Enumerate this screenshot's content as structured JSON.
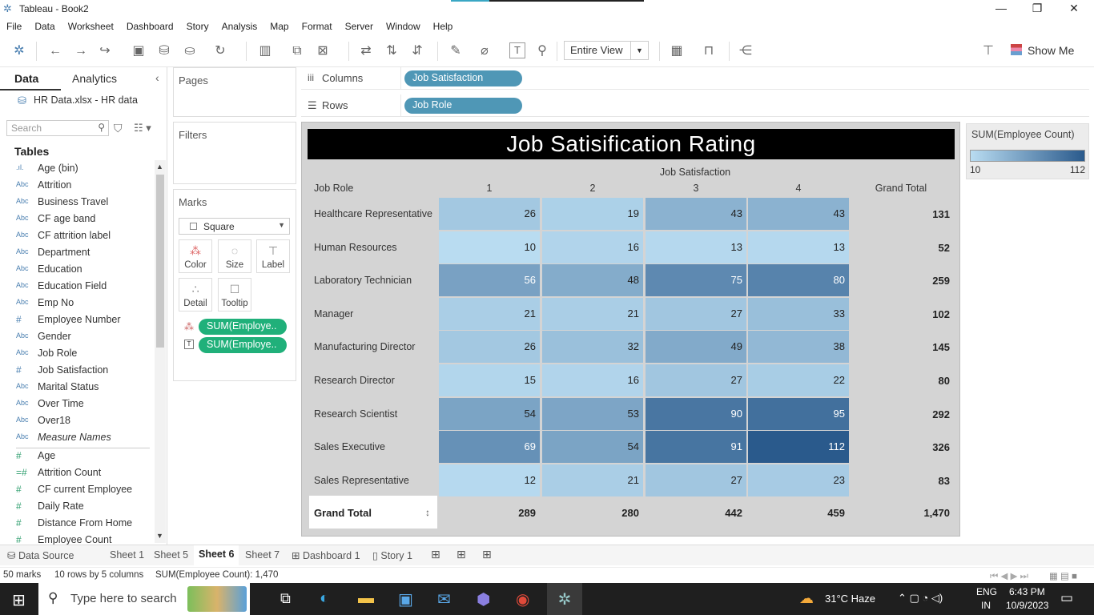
{
  "window": {
    "title": "Tableau - Book2"
  },
  "menu": [
    "File",
    "Data",
    "Worksheet",
    "Dashboard",
    "Story",
    "Analysis",
    "Map",
    "Format",
    "Server",
    "Window",
    "Help"
  ],
  "toolbar": {
    "fit": "Entire View",
    "show_me": "Show Me"
  },
  "data_pane": {
    "tab_data": "Data",
    "tab_analytics": "Analytics",
    "source": "HR Data.xlsx - HR data",
    "search_placeholder": "Search",
    "tables_label": "Tables",
    "dimensions": [
      {
        "type": "bin",
        "name": "Age (bin)"
      },
      {
        "type": "Abc",
        "name": "Attrition"
      },
      {
        "type": "Abc",
        "name": "Business Travel"
      },
      {
        "type": "Abc",
        "name": "CF age band"
      },
      {
        "type": "Abc",
        "name": "CF attrition label"
      },
      {
        "type": "Abc",
        "name": "Department"
      },
      {
        "type": "Abc",
        "name": "Education"
      },
      {
        "type": "Abc",
        "name": "Education Field"
      },
      {
        "type": "Abc",
        "name": "Emp No"
      },
      {
        "type": "#",
        "name": "Employee Number"
      },
      {
        "type": "Abc",
        "name": "Gender"
      },
      {
        "type": "Abc",
        "name": "Job Role"
      },
      {
        "type": "#",
        "name": "Job Satisfaction"
      },
      {
        "type": "Abc",
        "name": "Marital Status"
      },
      {
        "type": "Abc",
        "name": "Over Time"
      },
      {
        "type": "Abc",
        "name": "Over18"
      },
      {
        "type": "Abc",
        "name": "Measure Names"
      }
    ],
    "measures": [
      {
        "type": "#",
        "name": "Age"
      },
      {
        "type": "=#",
        "name": "Attrition Count"
      },
      {
        "type": "#",
        "name": "CF current Employee"
      },
      {
        "type": "#",
        "name": "Daily Rate"
      },
      {
        "type": "#",
        "name": "Distance From Home"
      },
      {
        "type": "#",
        "name": "Employee Count"
      }
    ]
  },
  "cards": {
    "pages": "Pages",
    "filters": "Filters",
    "marks": "Marks",
    "mark_type": "Square",
    "mark_buttons": [
      "Color",
      "Size",
      "Label",
      "Detail",
      "Tooltip"
    ],
    "mark_pills": [
      "SUM(Employe..",
      "SUM(Employe.."
    ]
  },
  "shelves": {
    "columns_label": "Columns",
    "columns_pill": "Job Satisfaction",
    "rows_label": "Rows",
    "rows_pill": "Job Role"
  },
  "view": {
    "title": "Job Satisificati on Rating",
    "col_group_header": "Job Satisfaction",
    "row_header": "Job Role",
    "columns": [
      "1",
      "2",
      "3",
      "4"
    ],
    "grand_total_label": "Grand Total"
  },
  "chart_data": {
    "type": "heatmap",
    "title": "Job Satisification Rating",
    "x_field": "Job Satisfaction",
    "y_field": "Job Role",
    "measure": "SUM(Employee Count)",
    "columns": [
      "1",
      "2",
      "3",
      "4"
    ],
    "rows": [
      {
        "role": "Healthcare Representative",
        "values": [
          26,
          19,
          43,
          43
        ],
        "total": "131"
      },
      {
        "role": "Human Resources",
        "values": [
          10,
          16,
          13,
          13
        ],
        "total": "52"
      },
      {
        "role": "Laboratory Technician",
        "values": [
          56,
          48,
          75,
          80
        ],
        "total": "259"
      },
      {
        "role": "Manager",
        "values": [
          21,
          21,
          27,
          33
        ],
        "total": "102"
      },
      {
        "role": "Manufacturing Director",
        "values": [
          26,
          32,
          49,
          38
        ],
        "total": "145"
      },
      {
        "role": "Research Director",
        "values": [
          15,
          16,
          27,
          22
        ],
        "total": "80"
      },
      {
        "role": "Research Scientist",
        "values": [
          54,
          53,
          90,
          95
        ],
        "total": "292"
      },
      {
        "role": "Sales Executive",
        "values": [
          69,
          54,
          91,
          112
        ],
        "total": "326"
      },
      {
        "role": "Sales Representative",
        "values": [
          12,
          21,
          27,
          23
        ],
        "total": "83"
      }
    ],
    "column_totals": [
      "289",
      "280",
      "442",
      "459"
    ],
    "grand_total": "1,470",
    "color_range": [
      10,
      112
    ],
    "colors": {
      "low": "#b9dcf1",
      "high": "#2a5a8c"
    }
  },
  "legend": {
    "title": "SUM(Employee Count)",
    "min": "10",
    "max": "112"
  },
  "sheet_tabs": [
    "Data Source",
    "Sheet 1",
    "Sheet 5",
    "Sheet 6",
    "Sheet 7",
    "Dashboard 1",
    "Story 1"
  ],
  "active_sheet": "Sheet 6",
  "status": {
    "marks": "50 marks",
    "dims": "10 rows by 5 columns",
    "sum": "SUM(Employee Count): 1,470"
  },
  "taskbar": {
    "search": "Type here to search",
    "weather": "31°C  Haze",
    "lang": "ENG",
    "region": "IN",
    "time": "6:43 PM",
    "date": "10/9/2023"
  }
}
